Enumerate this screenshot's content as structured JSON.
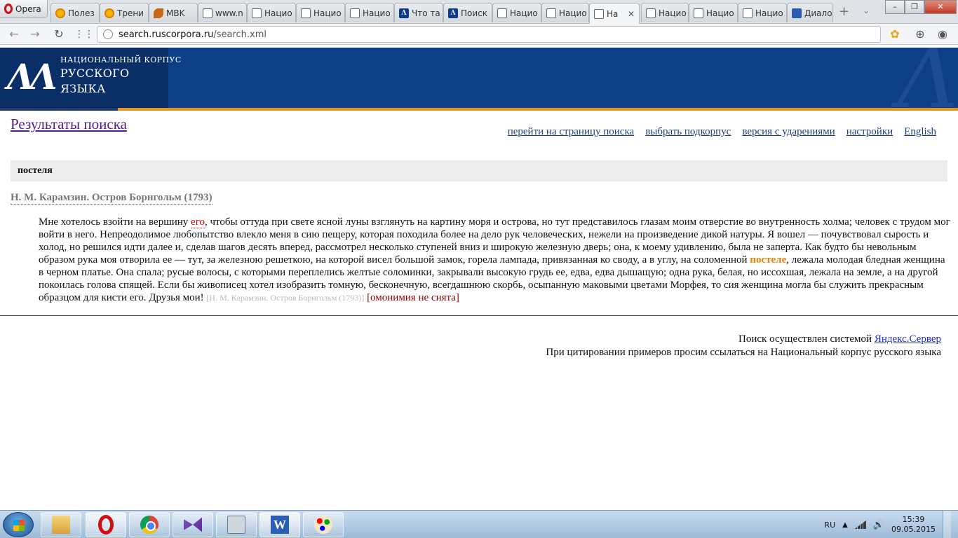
{
  "browser": {
    "menu_label": "Opera",
    "tabs": [
      {
        "label": "Полез",
        "icon": "orange-favicon"
      },
      {
        "label": "Трени",
        "icon": "flower-favicon"
      },
      {
        "label": "MBK",
        "icon": "leaf-favicon"
      },
      {
        "label": "www.n",
        "icon": "page-favicon"
      },
      {
        "label": "Нацио",
        "icon": "page-favicon"
      },
      {
        "label": "Нацио",
        "icon": "page-favicon"
      },
      {
        "label": "Нацио",
        "icon": "page-favicon"
      },
      {
        "label": "Что та",
        "icon": "ruscorpora-favicon"
      },
      {
        "label": "Поиск",
        "icon": "ruscorpora-favicon"
      },
      {
        "label": "Нацио",
        "icon": "page-favicon"
      },
      {
        "label": "Нацио",
        "icon": "page-favicon"
      },
      {
        "label": "На",
        "icon": "page-favicon",
        "active": true
      },
      {
        "label": "Нацио",
        "icon": "page-favicon"
      },
      {
        "label": "Нацио",
        "icon": "page-favicon"
      },
      {
        "label": "Нацио",
        "icon": "page-favicon"
      },
      {
        "label": "Диало",
        "icon": "dialog-favicon"
      }
    ],
    "tab_close_glyph": "✕",
    "new_tab_glyph": "+",
    "url_host": "search.ruscorpora.ru",
    "url_path": "/search.xml"
  },
  "site": {
    "logo_mark": "ΛΛ",
    "logo_line1": "НАЦИОНАЛЬНЫЙ КОРПУС",
    "logo_line2": "РУССКОГО",
    "logo_line3": "ЯЗЫКА",
    "watermark": "Λ"
  },
  "page": {
    "title": "Результаты поиска",
    "links": {
      "search_page": "перейти на страницу поиска",
      "subcorpus": "выбрать подкорпус",
      "stress": "версия с ударениями",
      "settings": "настройки",
      "english": "English"
    },
    "query": "постеля",
    "document_title": "Н. М. Карамзин. Остров Борнгольм (1793)",
    "snippet": {
      "before_ego": "Мне хотелось взойти на вершину ",
      "ego": "его",
      "before_hit": ", чтобы оттуда при свете ясной луны взглянуть на картину моря и острова, но тут представилось глазам моим отверстие во внутренность холма; человек с трудом мог войти в него. Непреодолимое любопытство влекло меня в сию пещеру, которая походила более на дело рук человеческих, нежели на произведение дикой натуры. Я вошел — почувствовал сырость и холод, но решился идти далее и, сделав шагов десять вперед, рассмотрел несколько ступеней вниз и широкую железную дверь; она, к моему удивлению, была не заперта. Как будто бы невольным образом рука моя отворила ее — тут, за железною решеткою, на которой висел большой замок, горела лампада, привязанная ко своду, а в углу, на соломенной ",
      "hit": "постеле",
      "after_hit": ", лежала молодая бледная женщина в черном платье. Она спала; русые волосы, с которыми переплелись желтые соломинки, закрывали высокую грудь ее, едва, едва дышащую; одна рука, белая, но иссохшая, лежала на земле, а на другой покоилась голова спящей. Если бы живописец хотел изобразить томную, бесконечную, всегдашнюю скорбь, осыпанную маковыми цветами Морфея, то сия женщина могла бы служить прекрасным образцом для кисти его. Друзья мои! ",
      "source_ref": "[Н. М. Карамзин. Остров Борнгольм (1793)]",
      "homonymy": "[омонимия не снята]"
    },
    "footer": {
      "line1_prefix": "Поиск осуществлен системой ",
      "line1_link": "Яндекс.Сервер",
      "line2": "При цитировании примеров просим ссылаться на Национальный корпус русского языка"
    }
  },
  "taskbar": {
    "apps": [
      "file-explorer",
      "opera",
      "chrome",
      "visual-studio",
      "calculator",
      "word",
      "paint"
    ],
    "language": "RU",
    "time": "15:39",
    "date": "09.05.2015"
  },
  "colors": {
    "header_blue": "#0d3f86",
    "accent_orange": "#e6951e",
    "hit_orange": "#e87f00",
    "visited_link": "#551a8b"
  }
}
